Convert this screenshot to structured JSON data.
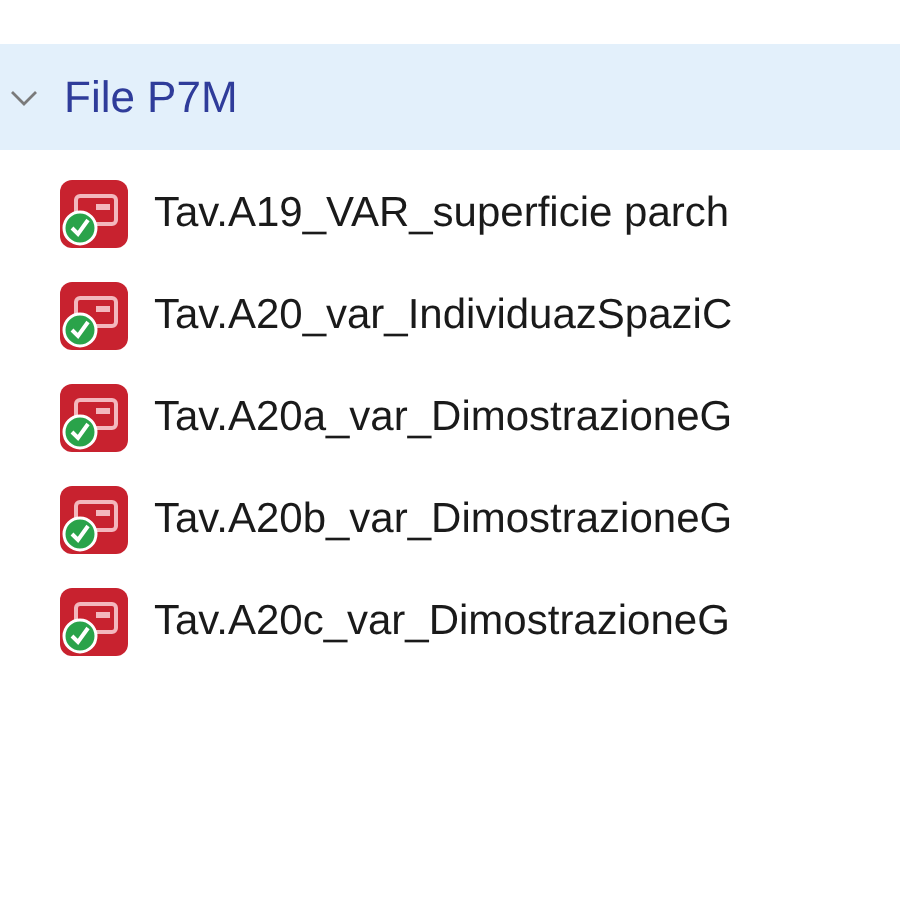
{
  "group": {
    "label": "File P7M",
    "expanded": true
  },
  "files": [
    {
      "name": "Tav.A19_VAR_superficie parch"
    },
    {
      "name": "Tav.A20_var_IndividuazSpaziC"
    },
    {
      "name": "Tav.A20a_var_DimostrazioneG"
    },
    {
      "name": "Tav.A20b_var_DimostrazioneG"
    },
    {
      "name": "Tav.A20c_var_DimostrazioneG"
    }
  ]
}
